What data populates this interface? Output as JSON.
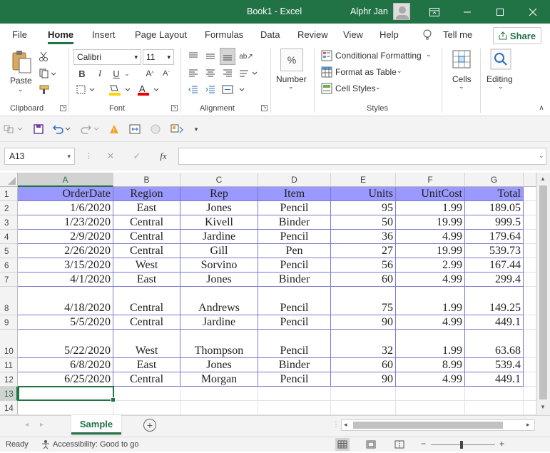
{
  "window": {
    "title": "Book1  -  Excel",
    "user": "Alphr Jan"
  },
  "tabs": [
    "File",
    "Home",
    "Insert",
    "Page Layout",
    "Formulas",
    "Data",
    "Review",
    "View",
    "Help"
  ],
  "tell_me": "Tell me",
  "share": "Share",
  "ribbon": {
    "paste": "Paste",
    "font_name": "Calibri",
    "font_size": "11",
    "number": "Number",
    "conditional_formatting": "Conditional Formatting",
    "format_as_table": "Format as Table",
    "cell_styles": "Cell Styles",
    "cells": "Cells",
    "editing": "Editing",
    "groups": {
      "clipboard": "Clipboard",
      "font": "Font",
      "alignment": "Alignment",
      "styles": "Styles"
    },
    "bold": "B",
    "italic": "I",
    "underline": "U",
    "percent": "%"
  },
  "formula_bar": {
    "name_box": "A13",
    "fx": "fx",
    "value": ""
  },
  "columns": [
    "A",
    "B",
    "C",
    "D",
    "E",
    "F",
    "G"
  ],
  "rows": [
    "1",
    "2",
    "3",
    "4",
    "5",
    "6",
    "7",
    "8",
    "9",
    "10",
    "11",
    "12",
    "13",
    "14"
  ],
  "table": {
    "headers": [
      "OrderDate",
      "Region",
      "Rep",
      "Item",
      "Units",
      "UnitCost",
      "Total"
    ],
    "data": [
      [
        "1/6/2020",
        "East",
        "Jones",
        "Pencil",
        "95",
        "1.99",
        "189.05"
      ],
      [
        "1/23/2020",
        "Central",
        "Kivell",
        "Binder",
        "50",
        "19.99",
        "999.5"
      ],
      [
        "2/9/2020",
        "Central",
        "Jardine",
        "Pencil",
        "36",
        "4.99",
        "179.64"
      ],
      [
        "2/26/2020",
        "Central",
        "Gill",
        "Pen",
        "27",
        "19.99",
        "539.73"
      ],
      [
        "3/15/2020",
        "West",
        "Sorvino",
        "Pencil",
        "56",
        "2.99",
        "167.44"
      ],
      [
        "4/1/2020",
        "East",
        "Jones",
        "Binder",
        "60",
        "4.99",
        "299.4"
      ],
      [
        "4/18/2020",
        "Central",
        "Andrews",
        "Pencil",
        "75",
        "1.99",
        "149.25"
      ],
      [
        "5/5/2020",
        "Central",
        "Jardine",
        "Pencil",
        "90",
        "4.99",
        "449.1"
      ],
      [
        "5/22/2020",
        "West",
        "Thompson",
        "Pencil",
        "32",
        "1.99",
        "63.68"
      ],
      [
        "6/8/2020",
        "East",
        "Jones",
        "Binder",
        "60",
        "8.99",
        "539.4"
      ],
      [
        "6/25/2020",
        "Central",
        "Morgan",
        "Pencil",
        "90",
        "4.99",
        "449.1"
      ]
    ]
  },
  "sheet": {
    "name": "Sample"
  },
  "status": {
    "ready": "Ready",
    "accessibility": "Accessibility: Good to go"
  },
  "colors": {
    "accent": "#217346",
    "header_fill": "#9999ff",
    "border": "#7a7ad0"
  }
}
